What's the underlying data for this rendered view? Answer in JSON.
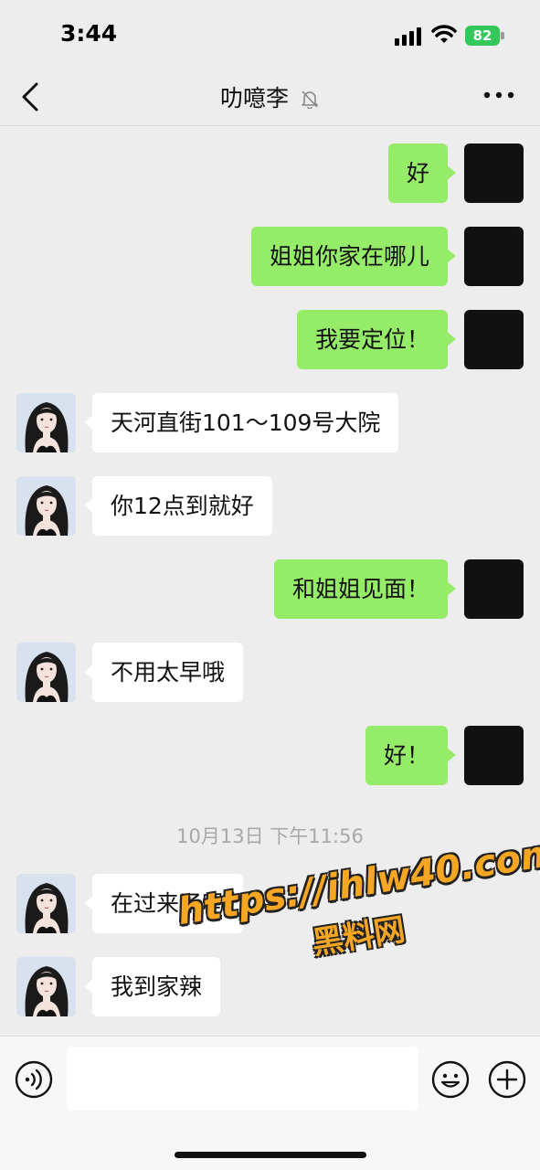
{
  "status_bar": {
    "time": "3:44",
    "battery": "82"
  },
  "nav": {
    "title": "叻噫李"
  },
  "messages": [
    {
      "side": "self",
      "text": "好"
    },
    {
      "side": "self",
      "text": "姐姐你家在哪儿"
    },
    {
      "side": "self",
      "text": "我要定位！"
    },
    {
      "side": "other",
      "text": "天河直街101～109号大院"
    },
    {
      "side": "other",
      "text": "你12点到就好"
    },
    {
      "side": "self",
      "text": "和姐姐见面！"
    },
    {
      "side": "other",
      "text": "不用太早哦"
    },
    {
      "side": "self",
      "text": "好！"
    },
    {
      "side": "other",
      "text": "在过来了吗"
    },
    {
      "side": "other",
      "text": "我到家辣"
    }
  ],
  "timestamp": "10月13日 下午11:56",
  "watermark": {
    "url": "https://ihlw40.com",
    "name": "黑料网"
  },
  "colors": {
    "self_bubble": "#95ec69",
    "other_bubble": "#ffffff",
    "background": "#ededed"
  },
  "icons": [
    "back-icon",
    "mute-bell-icon",
    "more-icon",
    "voice-icon",
    "emoji-icon",
    "plus-icon"
  ]
}
